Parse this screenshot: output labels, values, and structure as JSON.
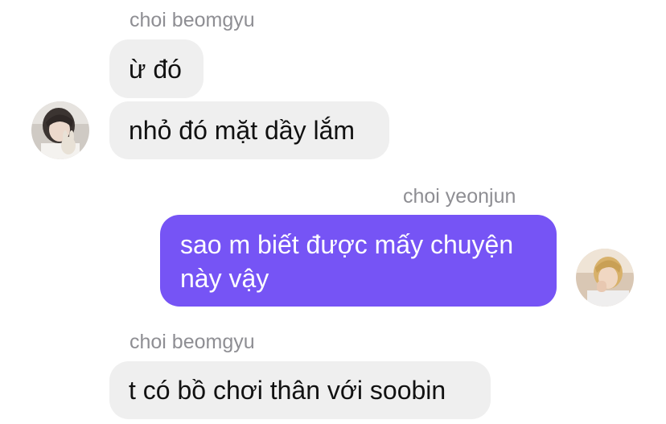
{
  "messages": [
    {
      "sender": "choi beomgyu",
      "text": "ừ đó"
    },
    {
      "text": "nhỏ đó mặt dầy lắm"
    },
    {
      "sender": "choi yeonjun",
      "text": "sao m biết được mấy chuyện này vậy"
    },
    {
      "sender": "choi beomgyu",
      "text": "t có bồ chơi thân với soobin"
    }
  ],
  "colors": {
    "incoming_bubble": "#efefef",
    "outgoing_bubble": "#7654f5",
    "sender_name": "#8e8e93"
  },
  "icons": {
    "beomgyu_avatar": "user-photo-avatar",
    "yeonjun_avatar": "user-photo-avatar"
  }
}
